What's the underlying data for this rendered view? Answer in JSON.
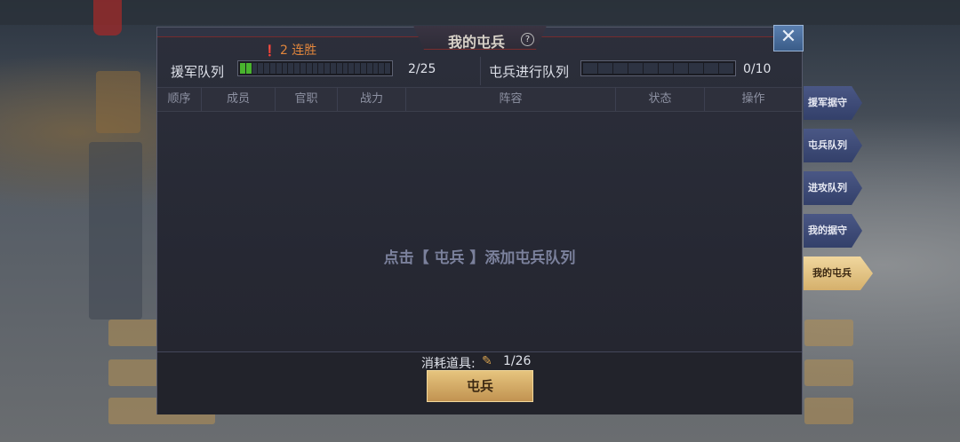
{
  "dialog": {
    "title": "我的屯兵",
    "close_icon": "close-icon"
  },
  "streak": {
    "text": "2 连胜"
  },
  "queues": {
    "reinforce": {
      "label": "援军队列",
      "count": "2/25",
      "filled": 2,
      "total": 25
    },
    "garrison": {
      "label": "屯兵进行队列",
      "count": "0/10",
      "filled": 0,
      "total": 10
    }
  },
  "table": {
    "columns": [
      "顺序",
      "成员",
      "官职",
      "战力",
      "阵容",
      "状态",
      "操作"
    ],
    "empty_hint": "点击【 屯兵 】添加屯兵队列"
  },
  "footer": {
    "consume_label": "消耗道具:",
    "consume_value": "1/26",
    "button_label": "屯兵"
  },
  "side_tabs": [
    {
      "label": "援军据守",
      "active": false
    },
    {
      "label": "屯兵队列",
      "active": false
    },
    {
      "label": "进攻队列",
      "active": false
    },
    {
      "label": "我的据守",
      "active": false
    },
    {
      "label": "我的屯兵",
      "active": true
    }
  ]
}
